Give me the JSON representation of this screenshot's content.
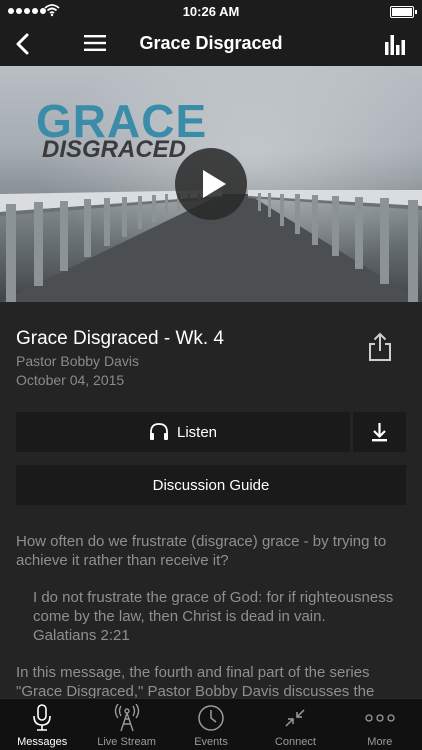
{
  "status_bar": {
    "time": "10:26 AM"
  },
  "nav": {
    "title": "Grace Disgraced",
    "back_icon": "chevron-left-icon",
    "menu_icon": "hamburger-icon",
    "stats_icon": "bar-chart-icon"
  },
  "hero": {
    "line1": "GRACE",
    "line2": "DISGRACED",
    "line1_color": "#3a8ca8"
  },
  "message": {
    "title": "Grace Disgraced - Wk. 4",
    "speaker": "Pastor Bobby Davis",
    "date": "October 04, 2015"
  },
  "actions": {
    "listen_label": "Listen",
    "discussion_label": "Discussion Guide"
  },
  "description": {
    "intro": "How often do we frustrate (disgrace) grace - by trying to achieve it rather than receive it?",
    "verse": "I do not frustrate the grace of God: for if righteousness come by the law, then Christ is dead in vain.",
    "reference": "Galatians 2:21",
    "summary": "In this message, the fourth and final part of the series \"Grace Disgraced,\" Pastor Bobby Davis discusses the"
  },
  "tabs": [
    {
      "label": "Messages",
      "icon": "microphone-icon",
      "active": true
    },
    {
      "label": "Live Stream",
      "icon": "broadcast-tower-icon",
      "active": false
    },
    {
      "label": "Events",
      "icon": "clock-icon",
      "active": false
    },
    {
      "label": "Connect",
      "icon": "arrows-in-icon",
      "active": false
    },
    {
      "label": "More",
      "icon": "more-dots-icon",
      "active": false
    }
  ]
}
